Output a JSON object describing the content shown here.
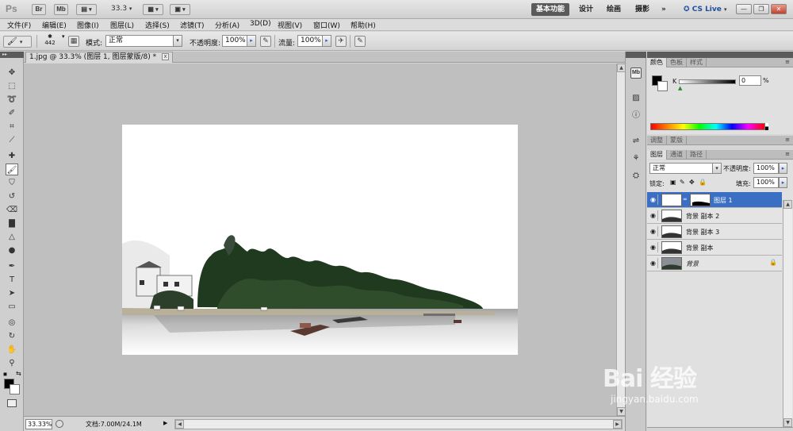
{
  "app": {
    "logo": "Ps",
    "bridge_button": "Br",
    "minibridge_button": "Mb",
    "zoom_dropdown": "33.3",
    "workspaces": [
      "基本功能",
      "设计",
      "绘画",
      "摄影"
    ],
    "more_workspaces": "»",
    "cs_live": "CS Live",
    "window_controls": [
      "—",
      "❐",
      "✕"
    ]
  },
  "menu": [
    "文件(F)",
    "编辑(E)",
    "图像(I)",
    "图层(L)",
    "选择(S)",
    "滤镜(T)",
    "分析(A)",
    "3D(D)",
    "视图(V)",
    "窗口(W)",
    "帮助(H)"
  ],
  "options": {
    "brush_size": "442",
    "mode_label": "模式:",
    "mode_value": "正常",
    "opacity_label": "不透明度:",
    "opacity_value": "100%",
    "flow_label": "流量:",
    "flow_value": "100%"
  },
  "document": {
    "tab_title": "1.jpg @ 33.3% (图层 1, 图层蒙版/8) *",
    "close": "x"
  },
  "status": {
    "zoom": "33.33%",
    "doc_size": "文档:7.00M/24.1M"
  },
  "color_panel": {
    "tabs": [
      "颜色",
      "色板",
      "样式"
    ],
    "channel": "K",
    "value": "0",
    "unit": "%"
  },
  "adjust_tabs": [
    "调整",
    "蒙版"
  ],
  "layers_panel": {
    "tabs": [
      "图层",
      "通道",
      "路径"
    ],
    "blend_mode": "正常",
    "opacity_label": "不透明度:",
    "opacity_value": "100%",
    "lock_label": "锁定:",
    "fill_label": "填充:",
    "fill_value": "100%",
    "layers": [
      {
        "name": "图层 1",
        "selected": true
      },
      {
        "name": "背景 副本 2",
        "selected": false
      },
      {
        "name": "背景 副本 3",
        "selected": false
      },
      {
        "name": "背景 副本",
        "selected": false
      },
      {
        "name": "背景",
        "selected": false,
        "locked": true
      }
    ]
  },
  "watermark": {
    "brand": "Bai 经验",
    "url": "jingyan.baidu.com"
  },
  "colors": {
    "selection": "#3a6fc4",
    "active_workspace": "#5a5a5a",
    "panel_grip": "#5b5b5b"
  }
}
